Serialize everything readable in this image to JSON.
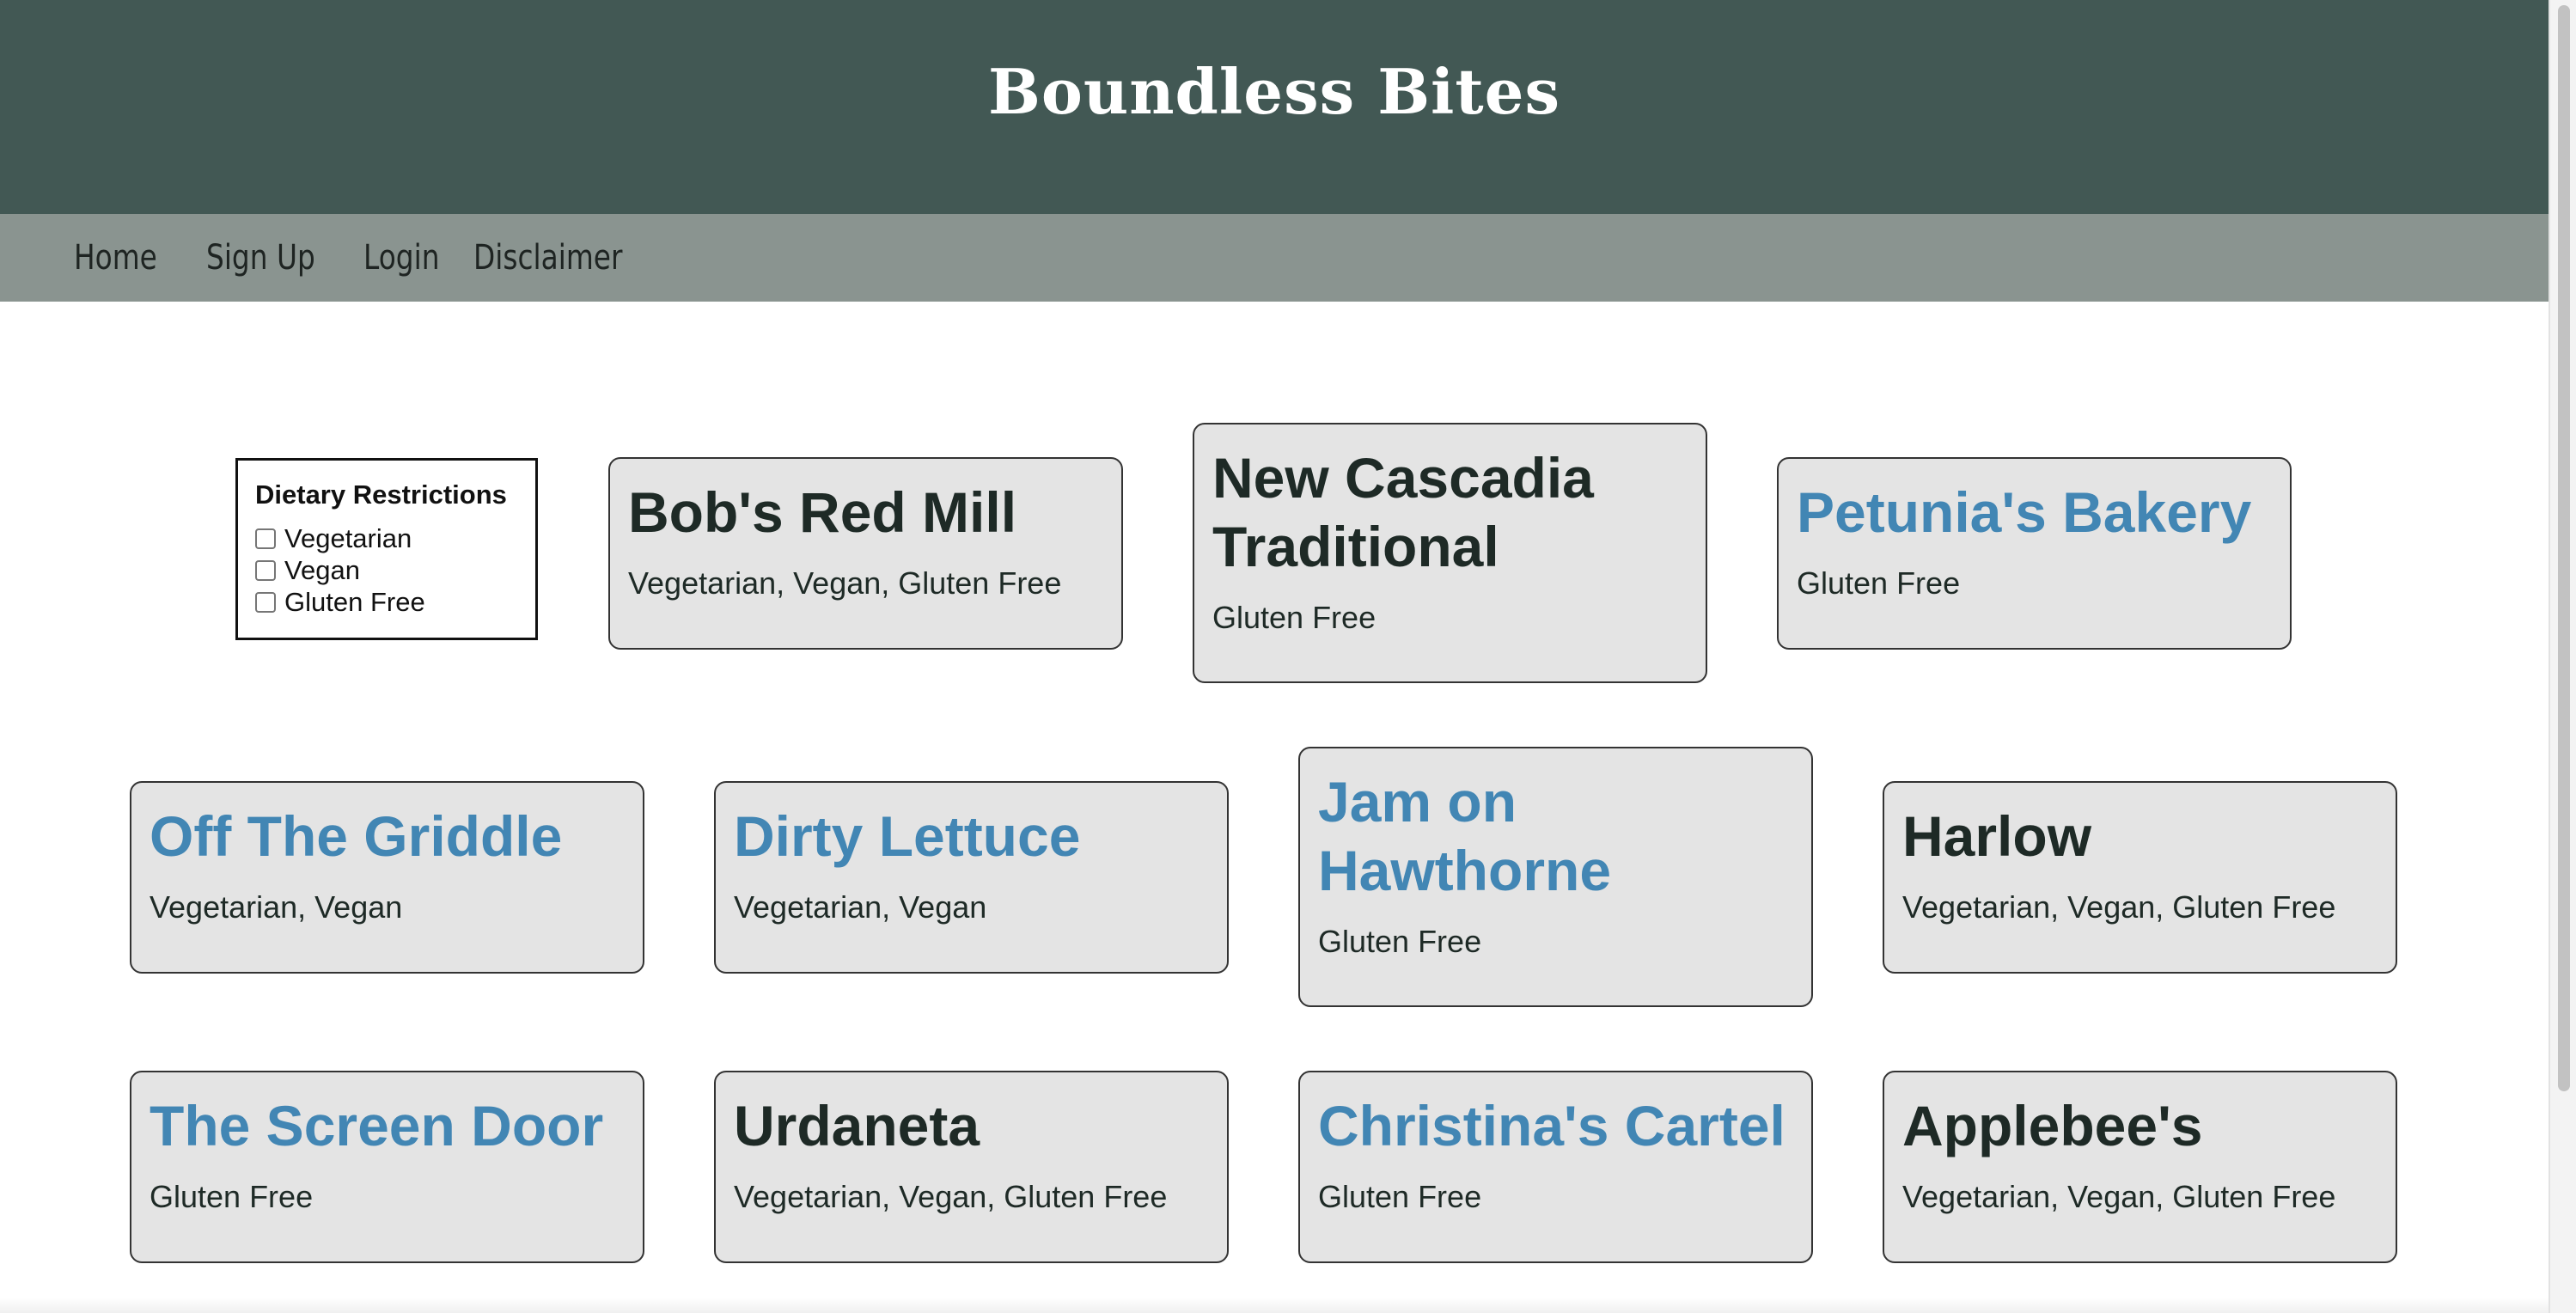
{
  "site": {
    "title": "Boundless Bites"
  },
  "nav": {
    "items": [
      "Home",
      "Sign Up",
      "Login",
      "Disclaimer"
    ]
  },
  "filters": {
    "title": "Dietary Restrictions",
    "options": [
      {
        "label": "Vegetarian",
        "checked": false
      },
      {
        "label": "Vegan",
        "checked": false
      },
      {
        "label": "Gluten Free",
        "checked": false
      }
    ]
  },
  "restaurants": [
    {
      "name": "Bob's Red Mill",
      "tags": "Vegetarian, Vegan, Gluten Free",
      "linked": false
    },
    {
      "name": "New Cascadia Traditional",
      "tags": "Gluten Free",
      "linked": false
    },
    {
      "name": "Petunia's Bakery",
      "tags": "Gluten Free",
      "linked": true
    },
    {
      "name": "Off The Griddle",
      "tags": "Vegetarian, Vegan",
      "linked": true
    },
    {
      "name": "Dirty Lettuce",
      "tags": "Vegetarian, Vegan",
      "linked": true
    },
    {
      "name": "Jam on Hawthorne",
      "tags": "Gluten Free",
      "linked": true
    },
    {
      "name": "Harlow",
      "tags": "Vegetarian, Vegan, Gluten Free",
      "linked": false
    },
    {
      "name": "The Screen Door",
      "tags": "Gluten Free",
      "linked": true
    },
    {
      "name": "Urdaneta",
      "tags": "Vegetarian, Vegan, Gluten Free",
      "linked": false
    },
    {
      "name": "Christina's Cartel",
      "tags": "Gluten Free",
      "linked": true
    },
    {
      "name": "Applebee's",
      "tags": "Vegetarian, Vegan, Gluten Free",
      "linked": false
    }
  ],
  "colors": {
    "header_bg": "#425854",
    "nav_bg": "#8a9490",
    "card_bg": "#e4e4e4",
    "link_name": "#4286b4",
    "plain_name": "#1e2a26"
  }
}
